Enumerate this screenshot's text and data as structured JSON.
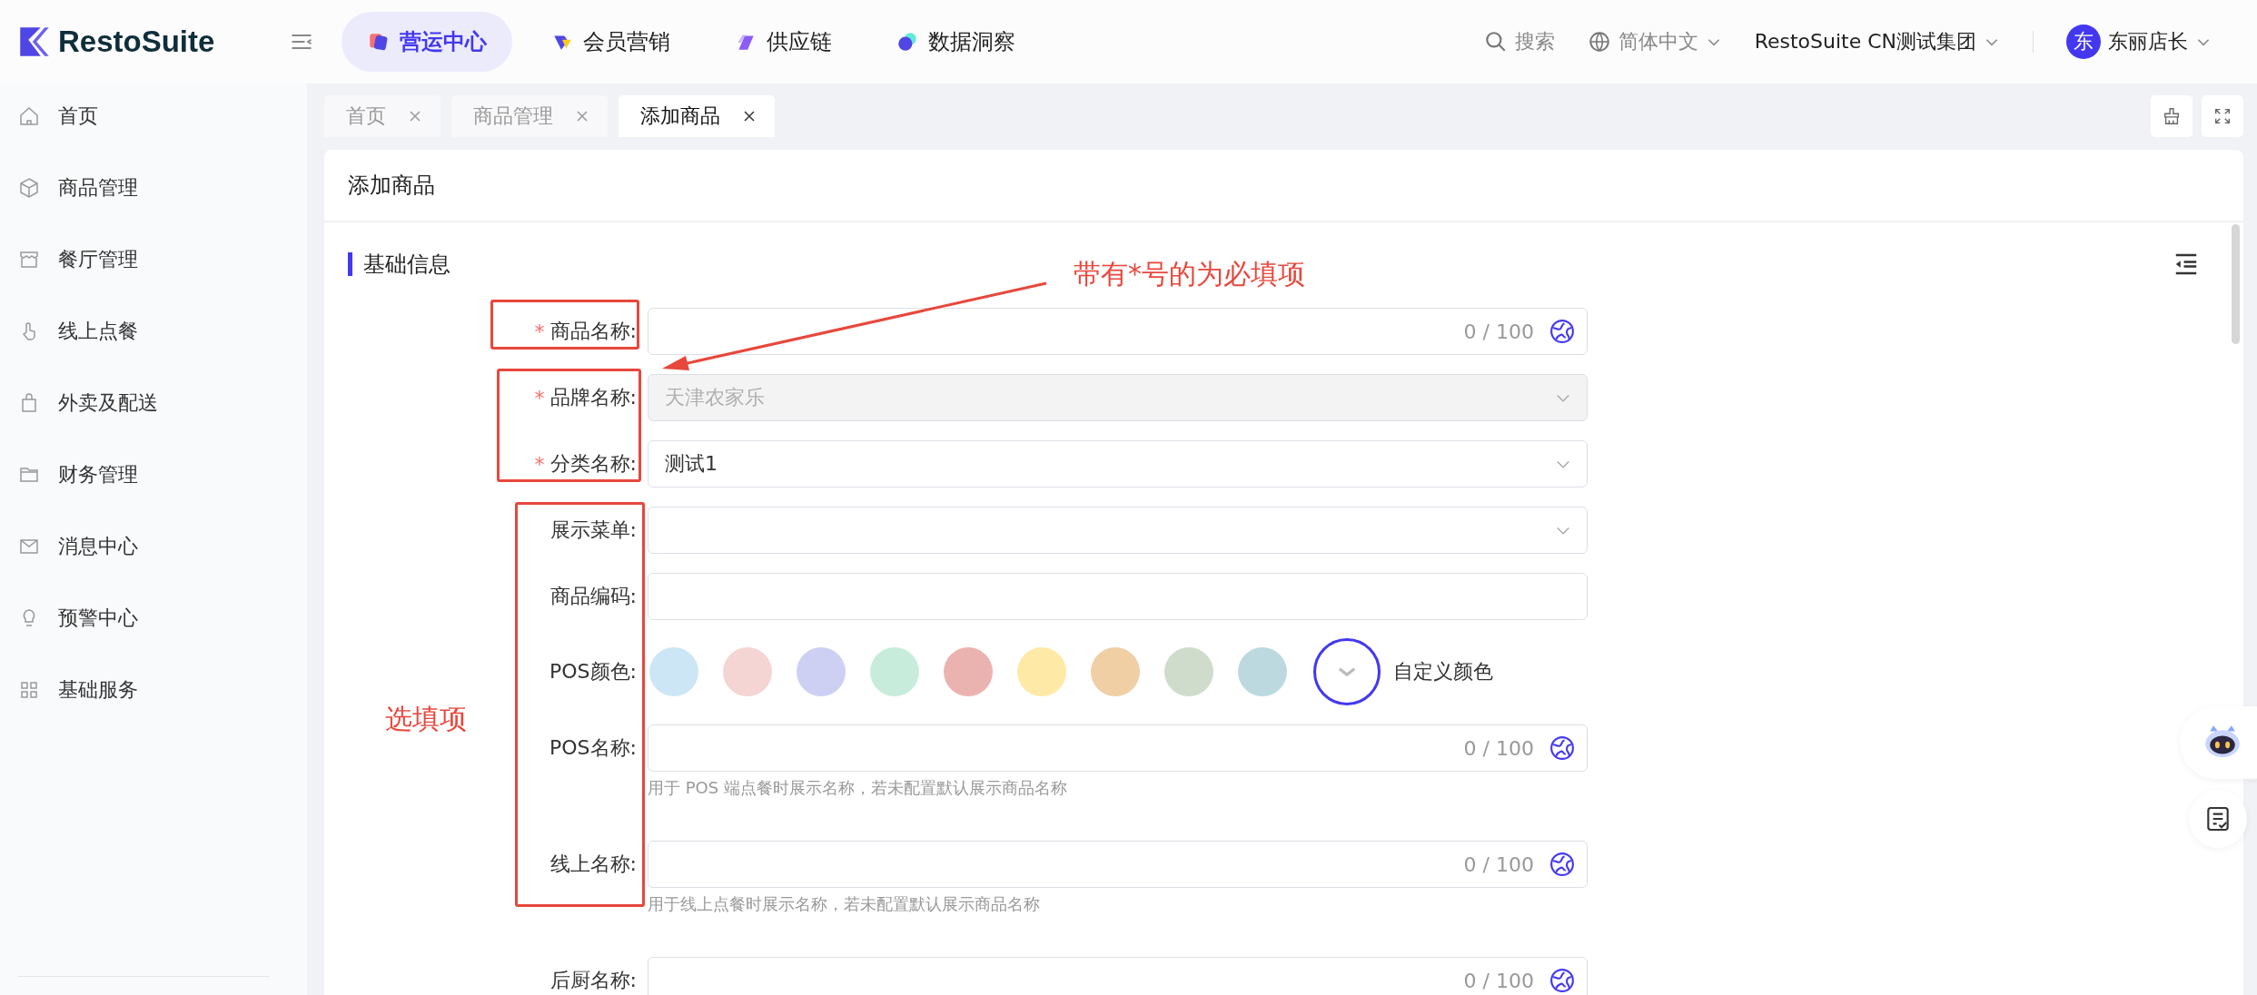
{
  "app": {
    "logo": "RestoSuite"
  },
  "top_nav": [
    {
      "label": "营运中心",
      "selected": true
    },
    {
      "label": "会员营销",
      "selected": false
    },
    {
      "label": "供应链",
      "selected": false
    },
    {
      "label": "数据洞察",
      "selected": false
    }
  ],
  "header_right": {
    "search": "搜索",
    "language": "简体中文",
    "organization": "RestoSuite CN测试集团",
    "user": {
      "avatar": "东",
      "name": "东丽店长"
    }
  },
  "sidebar": {
    "items": [
      {
        "label": "首页"
      },
      {
        "label": "商品管理"
      },
      {
        "label": "餐厅管理"
      },
      {
        "label": "线上点餐"
      },
      {
        "label": "外卖及配送"
      },
      {
        "label": "财务管理"
      },
      {
        "label": "消息中心"
      },
      {
        "label": "预警中心"
      },
      {
        "label": "基础服务"
      }
    ]
  },
  "page_tabs": [
    {
      "label": "首页",
      "selected": false
    },
    {
      "label": "商品管理",
      "selected": false
    },
    {
      "label": "添加商品",
      "selected": true
    }
  ],
  "card": {
    "title": "添加商品",
    "section": "基础信息"
  },
  "form": {
    "fields": [
      {
        "kind": "text",
        "required_mark": "*",
        "label": "商品名称:",
        "counter": "0 / 100"
      },
      {
        "kind": "select",
        "required_mark": "*",
        "label": "品牌名称:",
        "value": "天津农家乐",
        "disabled": true
      },
      {
        "kind": "select",
        "required_mark": "*",
        "label": "分类名称:",
        "value": "测试1",
        "disabled": false
      },
      {
        "kind": "select",
        "label": "展示菜单:",
        "disabled": false
      },
      {
        "kind": "plain",
        "label": "商品编码:"
      },
      {
        "kind": "colors",
        "label": "POS颜色:",
        "custom_label": "自定义颜色",
        "colors": [
          {
            "color": "#cde6f5"
          },
          {
            "color": "#f4d5d3"
          },
          {
            "color": "#cdd0f3"
          },
          {
            "color": "#c8ecdc"
          },
          {
            "color": "#ebb3b0"
          },
          {
            "color": "#feeaa6"
          },
          {
            "color": "#f0cfa5"
          },
          {
            "color": "#cfdccb"
          },
          {
            "color": "#bcd9e0"
          }
        ]
      },
      {
        "kind": "text",
        "label": "POS名称:",
        "counter": "0 / 100",
        "help": "用于 POS 端点餐时展示名称，若未配置默认展示商品名称"
      },
      {
        "kind": "text",
        "label": "线上名称:",
        "counter": "0 / 100",
        "help": "用于线上点餐时展示名称，若未配置默认展示商品名称"
      },
      {
        "kind": "text",
        "label": "后厨名称:",
        "counter": "0 / 100"
      }
    ]
  },
  "annotations": [
    {
      "kind": "note",
      "text": "带有*号的为必填项"
    },
    {
      "kind": "note",
      "text": "选填项"
    }
  ]
}
